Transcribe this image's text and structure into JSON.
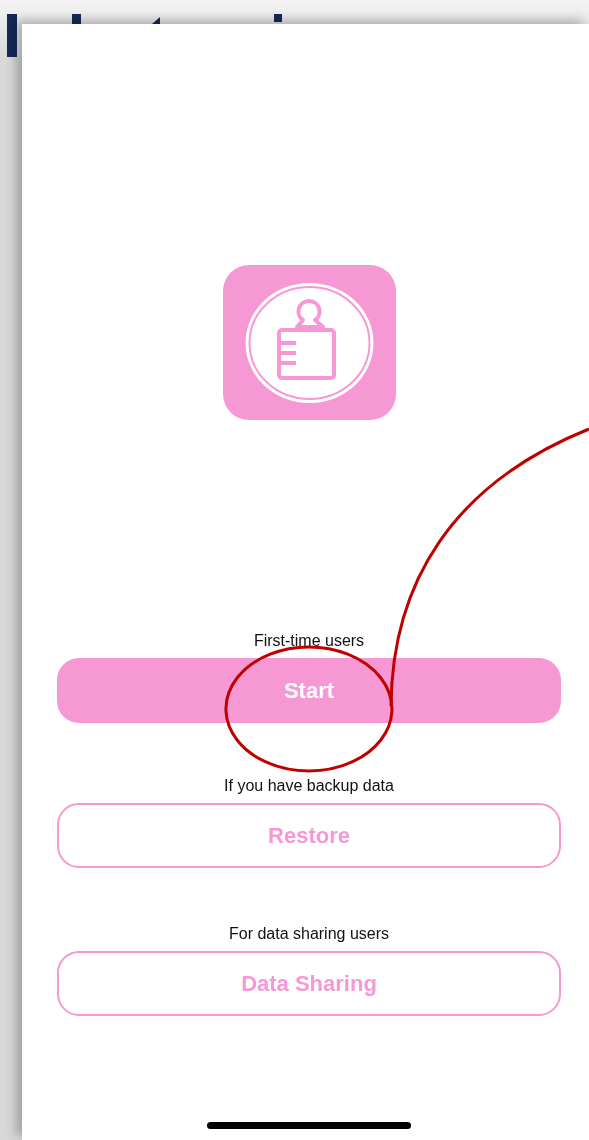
{
  "sections": [
    {
      "caption": "First-time users",
      "button": "Start",
      "kind": "filled"
    },
    {
      "caption": "If you have backup data",
      "button": "Restore",
      "kind": "outline"
    },
    {
      "caption": "For data sharing users",
      "button": "Data Sharing",
      "kind": "outline"
    }
  ]
}
